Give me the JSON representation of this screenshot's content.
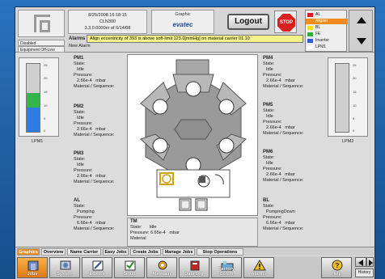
{
  "header": {
    "date_time": "8/25/2008 16:18:15",
    "tool_name": "CLN300",
    "version": "3.3.0.0000er of 6/14/08",
    "graphic_label": "Graphic",
    "brand": "evatec",
    "status_disabled": "Disabled",
    "status_equipment": "Equipment Off-Line",
    "alarms_label": "Alarms",
    "new_alarm": "New Alarm",
    "alarm_message": "Align eccentricity of 393 is above soft-limit 123.0[mmHg] on material carrier 01.10",
    "logout_label": "Logout",
    "stop_label": "STOP"
  },
  "legend": {
    "items": [
      {
        "label": "AL",
        "color": "#ffffff"
      },
      {
        "label": "Aligner",
        "color": "#f08c1e"
      },
      {
        "label": "BL",
        "color": "#ffffff"
      },
      {
        "label": "FE",
        "color": "#ffffff"
      },
      {
        "label": "Inverter",
        "color": "#ffffff"
      },
      {
        "label": "LPM1",
        "color": "#ffffff"
      }
    ],
    "swatches": [
      "#d92020",
      "#f08c1e",
      "#f0e020",
      "#30b030",
      "#3060d0",
      "#ffffff"
    ]
  },
  "gauges": {
    "left": {
      "label": "LPM1",
      "ticks": [
        "25",
        "20",
        "15",
        "10",
        "5",
        "0"
      ]
    },
    "right": {
      "label": "LPM2",
      "ticks": [
        "25",
        "20",
        "15",
        "10",
        "5",
        "0"
      ]
    }
  },
  "panels": [
    {
      "id": "PM1",
      "state_label": "State:",
      "state": "Idle",
      "pressure_label": "Pressure:",
      "pressure": "2.66e-4",
      "unit": "mbar",
      "material": "Material / Sequence:"
    },
    {
      "id": "PM2",
      "state_label": "State:",
      "state": "Idle",
      "pressure_label": "Pressure:",
      "pressure": "2.66e-4",
      "unit": "mbar",
      "material": "Material / Sequence:"
    },
    {
      "id": "PM3",
      "state_label": "State:",
      "state": "Idle",
      "pressure_label": "Pressure:",
      "pressure": "2.66e-4",
      "unit": "mbar",
      "material": "Material / Sequence:"
    },
    {
      "id": "PM4",
      "state_label": "State:",
      "state": "Idle",
      "pressure_label": "Pressure:",
      "pressure": "2.66e-4",
      "unit": "mbar",
      "material": "Material / Sequence:"
    },
    {
      "id": "PM5",
      "state_label": "State:",
      "state": "Idle",
      "pressure_label": "Pressure:",
      "pressure": "2.66e-4",
      "unit": "mbar",
      "material": "Material / Sequence:"
    },
    {
      "id": "PM6",
      "state_label": "State:",
      "state": "Idle",
      "pressure_label": "Pressure:",
      "pressure": "2.66e-4",
      "unit": "mbar",
      "material": "Material / Sequence:"
    }
  ],
  "al": {
    "id": "AL",
    "state_label": "State:",
    "state": "Pumping",
    "pressure_label": "Pressure:",
    "pressure": "6.66e-4",
    "unit": "mbar",
    "material": "Material / Sequence:"
  },
  "bl": {
    "id": "BL",
    "state_label": "State:",
    "state": "PumpingDown",
    "pressure_label": "Pressure:",
    "pressure": "6.66e-4",
    "unit": "mbar",
    "material": "Material / Sequence:"
  },
  "tm": {
    "id": "TM",
    "state_label": "State:",
    "state": "Idle",
    "pressure_label": "Pressure:",
    "pressure": "6.65e-4",
    "unit": "mbar",
    "material": "Material"
  },
  "tabs": [
    "Graphics",
    "Overview",
    "Name Carrier",
    "Easy Jobs",
    "Create Jobs",
    "Manage Jobs",
    "Stop Operations"
  ],
  "toolbar": [
    {
      "label": "Jobs",
      "icon": "jobs-icon"
    },
    {
      "label": "System",
      "icon": "system-icon"
    },
    {
      "label": "Editors",
      "icon": "editors-icon"
    },
    {
      "label": "Setup",
      "icon": "setup-icon"
    },
    {
      "label": "Maintain",
      "icon": "maintain-icon"
    },
    {
      "label": "Data Log",
      "icon": "data-log-icon"
    },
    {
      "label": "Factory Comm",
      "icon": "factory-comm-icon"
    },
    {
      "label": "Alarms",
      "icon": "alarm-icon"
    },
    {
      "label": "Help",
      "icon": "help-icon"
    },
    {
      "label": "History",
      "icon": "history-icon"
    }
  ]
}
